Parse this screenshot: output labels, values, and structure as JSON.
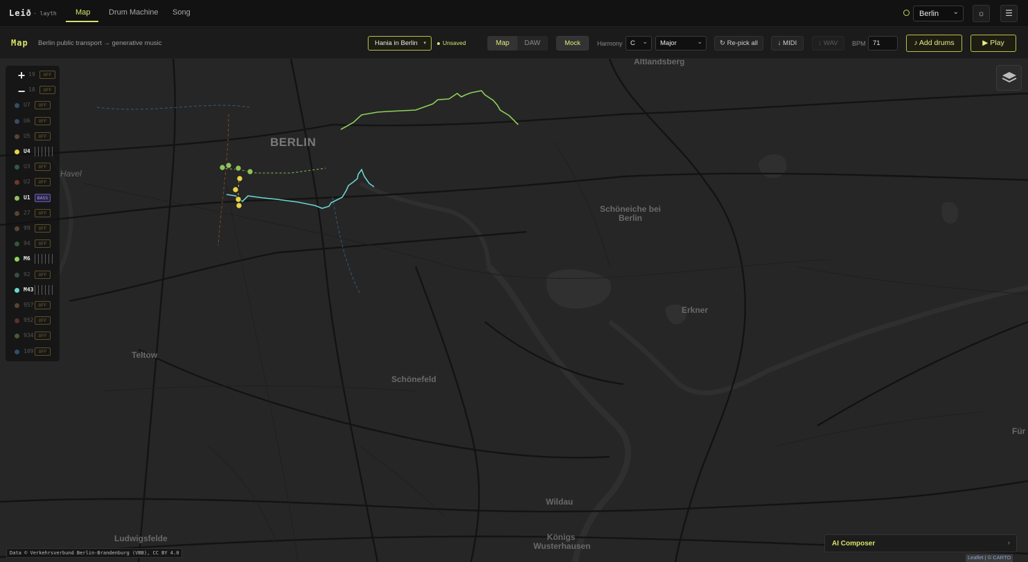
{
  "app": {
    "brand": "Leið",
    "brand_sub": "· layth"
  },
  "nav": {
    "tabs": [
      "Map",
      "Drum Machine",
      "Song"
    ],
    "active": "Map"
  },
  "city": {
    "selected": "Berlin"
  },
  "toolbar": {
    "title": "Map",
    "subtitle": "Berlin public transport → generative music",
    "project": "Hania in Berlin",
    "status": "Unsaved",
    "view_modes": [
      "Map",
      "DAW"
    ],
    "view_active": "Map",
    "mock_label": "Mock",
    "harmony_label": "Harmony",
    "harmony_key": "C",
    "harmony_scale": "Major",
    "repick_label": "↻ Re-pick all",
    "midi_label": "↓ MIDI",
    "wav_label": "↓ WAV",
    "bpm_label": "BPM",
    "bpm_value": "71",
    "add_drums_label": "♪ Add drums",
    "play_label": "▶ Play"
  },
  "lines": [
    {
      "name": "19",
      "state": "OFF",
      "on": false,
      "color": "#3c5a3c"
    },
    {
      "name": "18",
      "state": "OFF",
      "on": false,
      "color": "#3c5a3c"
    },
    {
      "name": "U7",
      "state": "OFF",
      "on": false,
      "color": "#2f4f6a"
    },
    {
      "name": "U6",
      "state": "OFF",
      "on": false,
      "color": "#3a4a6a"
    },
    {
      "name": "U5",
      "state": "OFF",
      "on": false,
      "color": "#5a4330"
    },
    {
      "name": "U4",
      "state": "",
      "on": true,
      "color": "#e6d34a"
    },
    {
      "name": "U3",
      "state": "OFF",
      "on": false,
      "color": "#2f5a4a"
    },
    {
      "name": "U2",
      "state": "OFF",
      "on": false,
      "color": "#6a3a2a"
    },
    {
      "name": "U1",
      "state": "BASS",
      "on": true,
      "color": "#8fc25a"
    },
    {
      "name": "27",
      "state": "OFF",
      "on": false,
      "color": "#5a4330"
    },
    {
      "name": "99",
      "state": "OFF",
      "on": false,
      "color": "#5a4330"
    },
    {
      "name": "94",
      "state": "OFF",
      "on": false,
      "color": "#2f5a3a"
    },
    {
      "name": "M6",
      "state": "",
      "on": true,
      "color": "#8fd25a"
    },
    {
      "name": "92",
      "state": "OFF",
      "on": false,
      "color": "#3a4a4a"
    },
    {
      "name": "M43",
      "state": "",
      "on": true,
      "color": "#6ad6d0"
    },
    {
      "name": "957",
      "state": "OFF",
      "on": false,
      "color": "#5a4330"
    },
    {
      "name": "952",
      "state": "OFF",
      "on": false,
      "color": "#5a3030"
    },
    {
      "name": "934",
      "state": "OFF",
      "on": false,
      "color": "#4a5a30"
    },
    {
      "name": "109",
      "state": "OFF",
      "on": false,
      "color": "#2f4f6a"
    }
  ],
  "map": {
    "places": [
      "Altlandsberg",
      "BERLIN",
      "Schöneiche bei Berlin",
      "Erkner",
      "Teltow",
      "Schönefeld",
      "Wildau",
      "Königs Wusterhausen",
      "Ludwigsfelde",
      "Havel",
      "Für"
    ],
    "route_colors": {
      "m6": "#8fd25a",
      "m43": "#6ad6d0",
      "u4": "#e6d34a",
      "u1": "#8fc25a"
    }
  },
  "ai_composer": {
    "title": "AI Composer"
  },
  "attribution": {
    "data": "Data © Verkehrsverbund Berlin-Brandenburg (VBB), CC BY 4.0",
    "tiles": "Leaflet | © CARTO"
  }
}
